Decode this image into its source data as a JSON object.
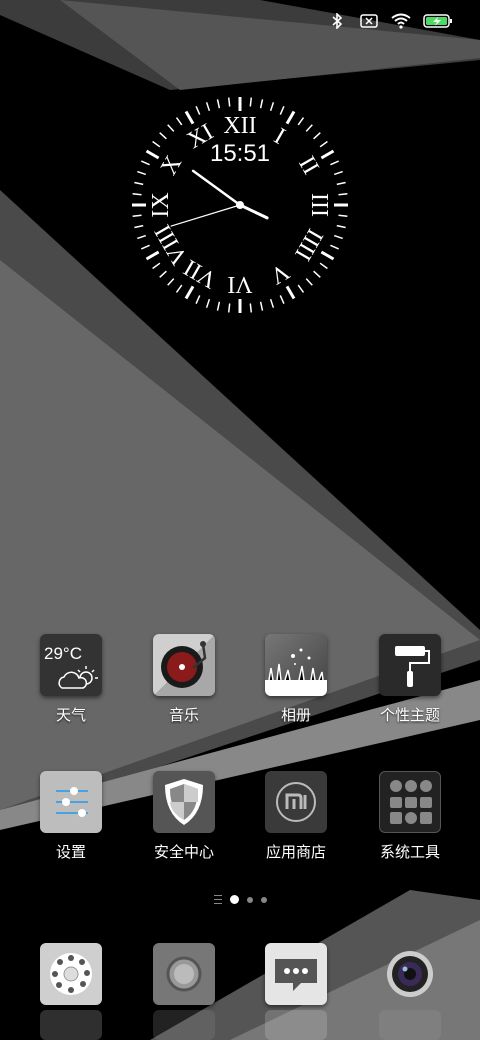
{
  "status_bar": {
    "icons": [
      "bluetooth-icon",
      "sim-x-icon",
      "wifi-icon",
      "battery-charging-icon"
    ]
  },
  "clock_widget": {
    "time": "15:51",
    "numerals": [
      "XII",
      "I",
      "II",
      "III",
      "IIII",
      "V",
      "VI",
      "VII",
      "VIII",
      "IX",
      "X",
      "XI"
    ]
  },
  "weather_icon_text": "29°C",
  "rows": [
    [
      {
        "label": "天气",
        "name": "weather"
      },
      {
        "label": "音乐",
        "name": "music"
      },
      {
        "label": "相册",
        "name": "gallery"
      },
      {
        "label": "个性主题",
        "name": "themes"
      }
    ],
    [
      {
        "label": "设置",
        "name": "settings"
      },
      {
        "label": "安全中心",
        "name": "security"
      },
      {
        "label": "应用商店",
        "name": "app-store"
      },
      {
        "label": "系统工具",
        "name": "tools"
      }
    ]
  ],
  "page_indicator": {
    "pages": 3,
    "current": 1
  },
  "dock": [
    "phone",
    "browser",
    "messages",
    "camera"
  ],
  "colors": {
    "background": "#000000",
    "panel_light": "#7a7a7a",
    "panel_dark": "#3a3a3a"
  }
}
